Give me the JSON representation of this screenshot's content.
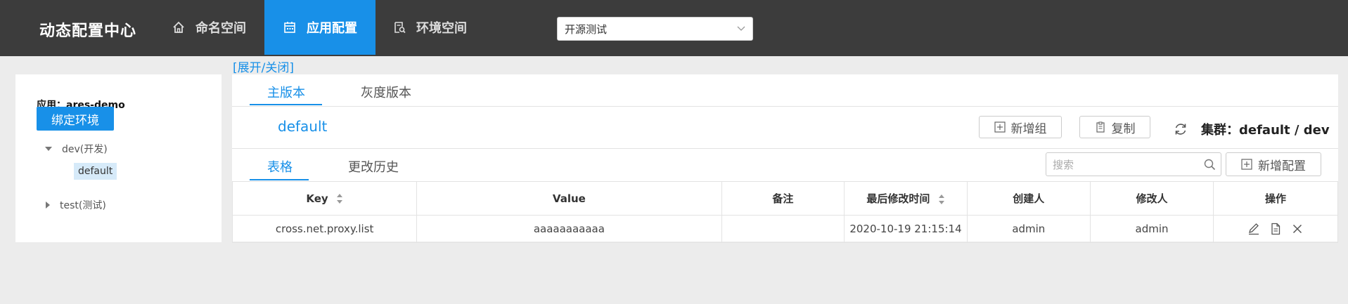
{
  "header": {
    "brand": "动态配置中心",
    "nav": [
      {
        "label": "命名空间",
        "icon": "home-icon",
        "active": false
      },
      {
        "label": "应用配置",
        "icon": "calendar-icon",
        "active": true
      },
      {
        "label": "环境空间",
        "icon": "search-doc-icon",
        "active": false
      }
    ],
    "env_select": {
      "value": "开源测试",
      "icon": "chevron-down-icon"
    }
  },
  "toggle_link": "[展开/关闭]",
  "sidebar": {
    "app_label": "应用：ares-demo",
    "bind_button": "绑定环境",
    "tree": [
      {
        "label": "dev(开发)",
        "expanded": true,
        "children": [
          "default"
        ]
      },
      {
        "label": "test(测试)",
        "expanded": false,
        "children": []
      }
    ]
  },
  "main": {
    "version_tabs": [
      "主版本",
      "灰度版本"
    ],
    "active_version_tab": "主版本",
    "cluster_name": "default",
    "buttons": {
      "add_group": "新增组",
      "copy": "复制",
      "add_config": "新增配置"
    },
    "cluster_info": "集群：default / dev",
    "view_tabs": [
      "表格",
      "更改历史"
    ],
    "active_view_tab": "表格",
    "search_placeholder": "搜索",
    "table": {
      "columns": [
        "Key",
        "Value",
        "备注",
        "最后修改时间",
        "创建人",
        "修改人",
        "操作"
      ],
      "rows": [
        {
          "key": "cross.net.proxy.list",
          "value": "aaaaaaaaaaa",
          "note": "",
          "modified": "2020-10-19 21:15:14",
          "creator": "admin",
          "modifier": "admin"
        }
      ]
    }
  },
  "colors": {
    "accent": "#1890e8",
    "topbar": "#3c3c3c",
    "page_bg": "#ececec"
  }
}
